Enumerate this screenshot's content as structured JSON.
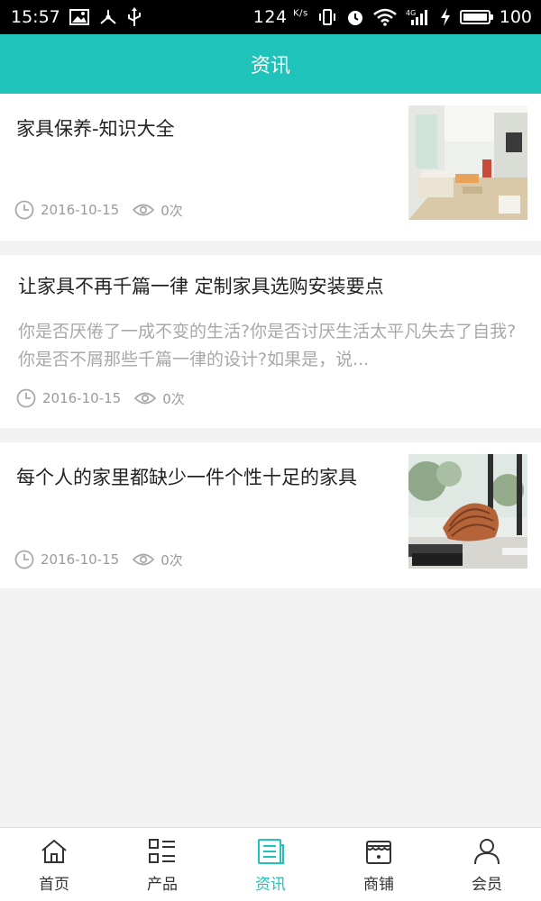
{
  "status_bar": {
    "time": "15:57",
    "speed": "124",
    "speed_unit": "K/s",
    "battery": "100",
    "left_icons": [
      "image-icon",
      "usb-share-icon",
      "usb-icon"
    ],
    "right_icons": [
      "vibrate-icon",
      "alarm-icon",
      "wifi-icon",
      "signal-4g-icon",
      "charging-icon",
      "battery-icon"
    ]
  },
  "header": {
    "title": "资讯"
  },
  "articles": [
    {
      "title": "家具保养-知识大全",
      "summary": "",
      "date": "2016-10-15",
      "views": "0次",
      "has_image": true,
      "image": "living-room-photo"
    },
    {
      "title": "让家具不再千篇一律 定制家具选购安装要点",
      "summary": "你是否厌倦了一成不变的生活?你是否讨厌生活太平凡失去了自我?你是否不屑那些千篇一律的设计?如果是，说...",
      "date": "2016-10-15",
      "views": "0次",
      "has_image": false
    },
    {
      "title": "每个人的家里都缺少一件个性十足的家具",
      "summary": "",
      "date": "2016-10-15",
      "views": "0次",
      "has_image": true,
      "image": "designer-chair-photo"
    }
  ],
  "bottom_nav": {
    "items": [
      {
        "label": "首页",
        "icon": "home-icon",
        "active": false
      },
      {
        "label": "产品",
        "icon": "product-list-icon",
        "active": false
      },
      {
        "label": "资讯",
        "icon": "news-icon",
        "active": true
      },
      {
        "label": "商铺",
        "icon": "shop-icon",
        "active": false
      },
      {
        "label": "会员",
        "icon": "member-icon",
        "active": false
      }
    ]
  },
  "colors": {
    "accent": "#1fc3ba",
    "background": "#f2f2f2",
    "muted_text": "#9a9a9a"
  }
}
